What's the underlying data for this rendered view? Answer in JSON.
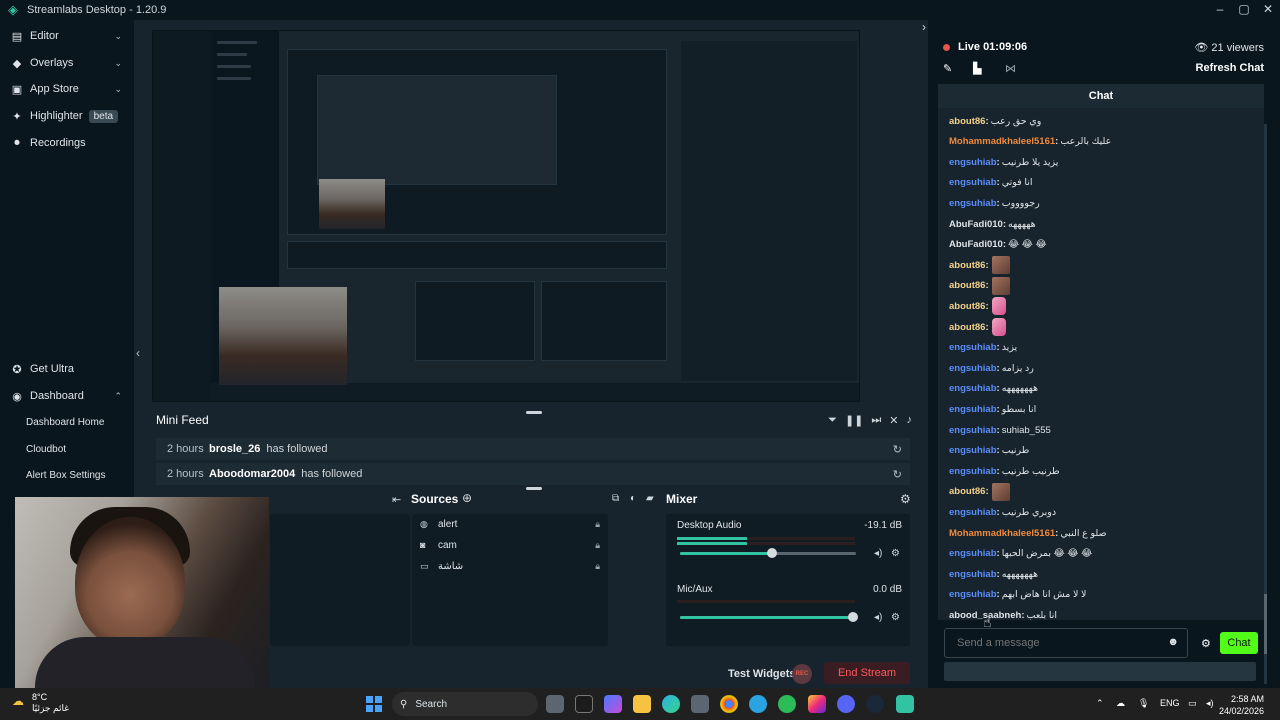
{
  "window": {
    "title": "Streamlabs Desktop - 1.20.9"
  },
  "sidebar": {
    "items": [
      {
        "label": "Editor",
        "icon": "editor-icon",
        "expandable": true
      },
      {
        "label": "Overlays",
        "icon": "overlays-icon",
        "expandable": true
      },
      {
        "label": "App Store",
        "icon": "app-store-icon",
        "expandable": true
      },
      {
        "label": "Highlighter",
        "icon": "highlighter-icon",
        "badge": "beta"
      },
      {
        "label": "Recordings",
        "icon": "recordings-icon"
      }
    ],
    "bottom": [
      {
        "label": "Get Ultra",
        "icon": "ultra-icon"
      },
      {
        "label": "Dashboard",
        "icon": "dashboard-icon",
        "expanded": true
      }
    ],
    "dashboard_sub": [
      "Dashboard Home",
      "Cloudbot",
      "Alert Box Settings"
    ]
  },
  "minifeed": {
    "title": "Mini Feed",
    "rows": [
      {
        "time": "2 hours",
        "name": "brosle_26",
        "action": "has followed"
      },
      {
        "time": "2 hours",
        "name": "Aboodomar2004",
        "action": "has followed"
      }
    ]
  },
  "sources": {
    "title": "Sources",
    "items": [
      {
        "label": "alert",
        "icon": "globe-icon"
      },
      {
        "label": "cam",
        "icon": "camera-icon"
      },
      {
        "label": "شاشة",
        "icon": "monitor-icon"
      }
    ]
  },
  "mixer": {
    "title": "Mixer",
    "channels": [
      {
        "label": "Desktop Audio",
        "value": "-19.1 dB",
        "level": 0.56
      },
      {
        "label": "Mic/Aux",
        "value": "0.0 dB",
        "level": 1.0
      }
    ]
  },
  "bottom": {
    "test_widgets": "Test Widgets",
    "rec": "REC",
    "end_stream": "End Stream"
  },
  "chat": {
    "live": "Live 01:09:06",
    "viewers": "21 viewers",
    "refresh": "Refresh Chat",
    "title": "Chat",
    "placeholder": "Send a message",
    "send": "Chat",
    "messages": [
      {
        "user": "about86",
        "text": "وي حق رعب",
        "color": "yellow"
      },
      {
        "user": "Mohammadkhaleel5161",
        "text": "عليك بالرعب",
        "color": "orange"
      },
      {
        "user": "engsuhiab",
        "text": "يزيد يلا طرنيب",
        "color": "blue"
      },
      {
        "user": "engsuhiab",
        "text": "انا فوتي",
        "color": "blue"
      },
      {
        "user": "engsuhiab",
        "text": "رجووووب",
        "color": "blue"
      },
      {
        "user": "AbuFadi010",
        "text": "هههههه",
        "color": "grey"
      },
      {
        "user": "AbuFadi010",
        "text": "😂 😂 😂",
        "color": "grey"
      },
      {
        "user": "about86",
        "text": "",
        "emote": "brown",
        "color": "yellow"
      },
      {
        "user": "about86",
        "text": "",
        "emote": "brown",
        "color": "yellow"
      },
      {
        "user": "about86",
        "text": "",
        "emote": "pink",
        "color": "yellow"
      },
      {
        "user": "about86",
        "text": "",
        "emote": "pink",
        "color": "yellow"
      },
      {
        "user": "engsuhiab",
        "text": "يزيد",
        "color": "blue"
      },
      {
        "user": "engsuhiab",
        "text": "رد يزامه",
        "color": "blue"
      },
      {
        "user": "engsuhiab",
        "text": "هههههههه",
        "color": "blue"
      },
      {
        "user": "engsuhiab",
        "text": "انا بسطو",
        "color": "blue"
      },
      {
        "user": "engsuhiab",
        "text": "suhiab_555",
        "color": "blue"
      },
      {
        "user": "engsuhiab",
        "text": "طرنيب",
        "color": "blue"
      },
      {
        "user": "engsuhiab",
        "text": "طرنيب طرنيب",
        "color": "blue"
      },
      {
        "user": "about86",
        "text": "",
        "emote": "brown",
        "color": "yellow"
      },
      {
        "user": "engsuhiab",
        "text": "دوبري طرنيب",
        "color": "blue"
      },
      {
        "user": "Mohammadkhaleel5161",
        "text": "صلو ع النبي",
        "color": "orange"
      },
      {
        "user": "engsuhiab",
        "text": "بمرض الحبها 😂 😂 😂",
        "color": "blue"
      },
      {
        "user": "engsuhiab",
        "text": "هههههههه",
        "color": "blue"
      },
      {
        "user": "engsuhiab",
        "text": "لا لا مش انا هاض ابهم",
        "color": "blue"
      },
      {
        "user": "abood_saabneh",
        "text": "انا بلعب",
        "color": "grey"
      }
    ]
  },
  "taskbar": {
    "weather_temp": "8°C",
    "weather_desc": "غائم جزئيًا",
    "search": "Search",
    "lang": "ENG",
    "time": "2:58 AM",
    "date": "24/02/2026"
  }
}
